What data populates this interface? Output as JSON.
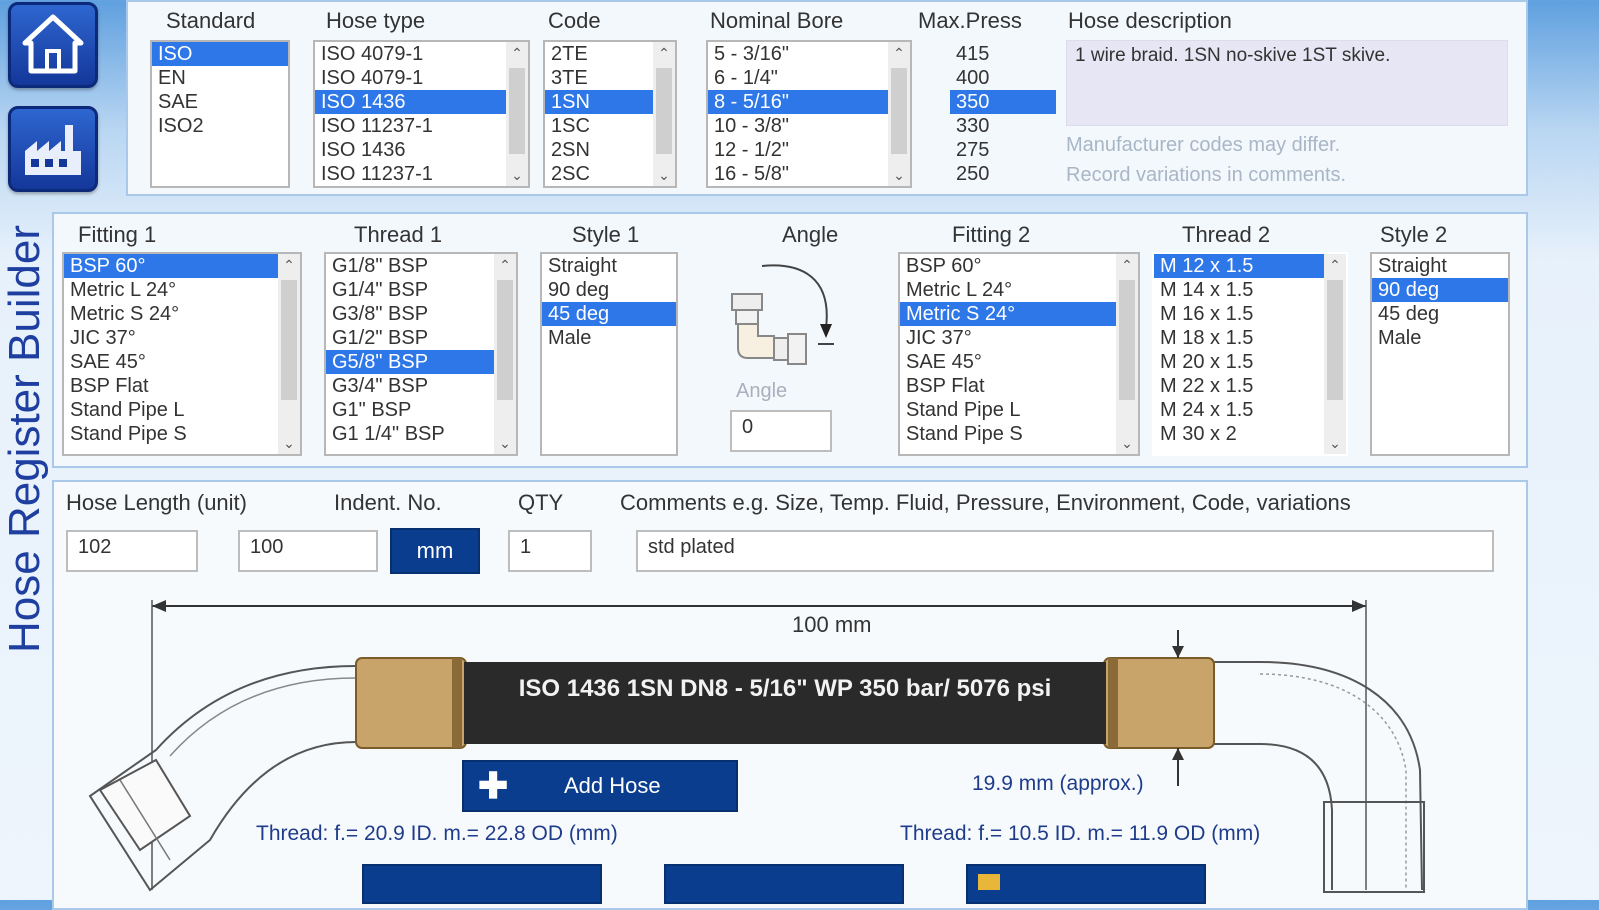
{
  "app": {
    "vertical_title": "Hose Register Builder"
  },
  "nav": {
    "home_icon": "home-icon",
    "factory_icon": "factory-icon"
  },
  "top": {
    "standard": {
      "label": "Standard",
      "items": [
        "ISO",
        "EN",
        "SAE",
        "ISO2"
      ],
      "selected": 0
    },
    "hose_type": {
      "label": "Hose type",
      "items": [
        "ISO 4079-1",
        "ISO 4079-1",
        "ISO 1436",
        "ISO 11237-1",
        "ISO 1436",
        "ISO 11237-1"
      ],
      "selected": 2
    },
    "code": {
      "label": "Code",
      "items": [
        "2TE",
        "3TE",
        "1SN",
        "1SC",
        "2SN",
        "2SC"
      ],
      "selected": 2
    },
    "nominal_bore": {
      "label": "Nominal Bore",
      "items": [
        "5 - 3/16\"",
        "6 - 1/4\"",
        "8 - 5/16\"",
        "10 - 3/8\"",
        "12 - 1/2\"",
        "16 - 5/8\""
      ],
      "selected": 2
    },
    "max_press": {
      "label": "Max.Press",
      "items": [
        "415",
        "400",
        "350",
        "330",
        "275",
        "250"
      ],
      "selected": 2
    },
    "hose_description": {
      "label": "Hose description",
      "value": "1 wire braid. 1SN no-skive 1ST skive."
    },
    "note_line1": "Manufacturer codes may differ.",
    "note_line2": "Record variations in comments."
  },
  "mid": {
    "fitting1": {
      "label": "Fitting 1",
      "items": [
        "BSP 60°",
        "Metric L 24°",
        "Metric S 24°",
        "JIC 37°",
        "SAE 45°",
        "BSP Flat",
        "Stand Pipe L",
        "Stand Pipe S"
      ],
      "selected": 0
    },
    "thread1": {
      "label": "Thread 1",
      "items": [
        "G1/8\" BSP",
        "G1/4\" BSP",
        "G3/8\" BSP",
        "G1/2\" BSP",
        "G5/8\" BSP",
        "G3/4\" BSP",
        "G1\" BSP",
        "G1 1/4\" BSP"
      ],
      "selected": 4
    },
    "style1": {
      "label": "Style 1",
      "items": [
        "Straight",
        "90 deg",
        "45 deg",
        "Male"
      ],
      "selected": 2
    },
    "angle": {
      "label": "Angle",
      "input_label": "Angle",
      "value": "0"
    },
    "fitting2": {
      "label": "Fitting 2",
      "items": [
        "BSP 60°",
        "Metric L 24°",
        "Metric S 24°",
        "JIC 37°",
        "SAE 45°",
        "BSP Flat",
        "Stand Pipe L",
        "Stand Pipe S"
      ],
      "selected": 2
    },
    "thread2": {
      "label": "Thread 2",
      "items": [
        "M 12 x 1.5",
        "M 14 x 1.5",
        "M 16 x 1.5",
        "M 18 x 1.5",
        "M 20 x 1.5",
        "M 22 x 1.5",
        "M 24 x 1.5",
        "M 30 x 2"
      ],
      "selected": 0
    },
    "style2": {
      "label": "Style 2",
      "items": [
        "Straight",
        "90 deg",
        "45 deg",
        "Male"
      ],
      "selected": 1
    }
  },
  "bottom": {
    "hose_length_label": "Hose Length (unit)",
    "indent_label": "Indent. No.",
    "qty_label": "QTY",
    "comments_label": "Comments e.g. Size, Temp. Fluid, Pressure, Environment, Code, variations",
    "hose_length_value": "102",
    "indent_value": "100",
    "unit_button": "mm",
    "qty_value": "1",
    "comments_value": "std plated",
    "dimension_label": "100 mm",
    "hose_print": "ISO 1436 1SN DN8 - 5/16\" WP 350 bar/ 5076 psi",
    "add_hose_label": "Add Hose",
    "diameter_label": "19.9 mm (approx.)",
    "thread1_info": "Thread: f.= 20.9 ID. m.= 22.8 OD (mm)",
    "thread2_info": "Thread: f.= 10.5 ID. m.= 11.9 OD (mm)"
  },
  "colors": {
    "accent": "#2e77e8",
    "dark_button": "#0b3d8f",
    "nav": "#14379a",
    "ferrule": "#c9a46a",
    "hose": "#2a2a2a"
  }
}
